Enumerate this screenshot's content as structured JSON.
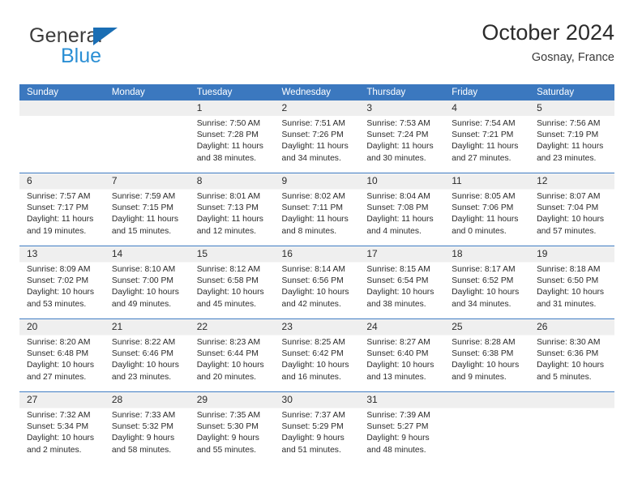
{
  "brand": {
    "name_top": "General",
    "name_bottom": "Blue",
    "triangle_color": "#1a6eb4",
    "blue_text_color": "#2b8fd4"
  },
  "header": {
    "title": "October 2024",
    "location": "Gosnay, France"
  },
  "theme": {
    "header_row_bg": "#3b78bf",
    "header_row_text": "#ffffff",
    "daynum_band_bg": "#efefef",
    "row_divider": "#3b78bf",
    "body_text": "#2b2b2b"
  },
  "calendar": {
    "weekday_headers": [
      "Sunday",
      "Monday",
      "Tuesday",
      "Wednesday",
      "Thursday",
      "Friday",
      "Saturday"
    ],
    "labels": {
      "sunrise": "Sunrise:",
      "sunset": "Sunset:",
      "daylight": "Daylight:"
    },
    "weeks": [
      [
        {
          "day": "",
          "sunrise": "",
          "sunset": "",
          "daylight": ""
        },
        {
          "day": "",
          "sunrise": "",
          "sunset": "",
          "daylight": ""
        },
        {
          "day": "1",
          "sunrise": "Sunrise: 7:50 AM",
          "sunset": "Sunset: 7:28 PM",
          "daylight": "Daylight: 11 hours and 38 minutes."
        },
        {
          "day": "2",
          "sunrise": "Sunrise: 7:51 AM",
          "sunset": "Sunset: 7:26 PM",
          "daylight": "Daylight: 11 hours and 34 minutes."
        },
        {
          "day": "3",
          "sunrise": "Sunrise: 7:53 AM",
          "sunset": "Sunset: 7:24 PM",
          "daylight": "Daylight: 11 hours and 30 minutes."
        },
        {
          "day": "4",
          "sunrise": "Sunrise: 7:54 AM",
          "sunset": "Sunset: 7:21 PM",
          "daylight": "Daylight: 11 hours and 27 minutes."
        },
        {
          "day": "5",
          "sunrise": "Sunrise: 7:56 AM",
          "sunset": "Sunset: 7:19 PM",
          "daylight": "Daylight: 11 hours and 23 minutes."
        }
      ],
      [
        {
          "day": "6",
          "sunrise": "Sunrise: 7:57 AM",
          "sunset": "Sunset: 7:17 PM",
          "daylight": "Daylight: 11 hours and 19 minutes."
        },
        {
          "day": "7",
          "sunrise": "Sunrise: 7:59 AM",
          "sunset": "Sunset: 7:15 PM",
          "daylight": "Daylight: 11 hours and 15 minutes."
        },
        {
          "day": "8",
          "sunrise": "Sunrise: 8:01 AM",
          "sunset": "Sunset: 7:13 PM",
          "daylight": "Daylight: 11 hours and 12 minutes."
        },
        {
          "day": "9",
          "sunrise": "Sunrise: 8:02 AM",
          "sunset": "Sunset: 7:11 PM",
          "daylight": "Daylight: 11 hours and 8 minutes."
        },
        {
          "day": "10",
          "sunrise": "Sunrise: 8:04 AM",
          "sunset": "Sunset: 7:08 PM",
          "daylight": "Daylight: 11 hours and 4 minutes."
        },
        {
          "day": "11",
          "sunrise": "Sunrise: 8:05 AM",
          "sunset": "Sunset: 7:06 PM",
          "daylight": "Daylight: 11 hours and 0 minutes."
        },
        {
          "day": "12",
          "sunrise": "Sunrise: 8:07 AM",
          "sunset": "Sunset: 7:04 PM",
          "daylight": "Daylight: 10 hours and 57 minutes."
        }
      ],
      [
        {
          "day": "13",
          "sunrise": "Sunrise: 8:09 AM",
          "sunset": "Sunset: 7:02 PM",
          "daylight": "Daylight: 10 hours and 53 minutes."
        },
        {
          "day": "14",
          "sunrise": "Sunrise: 8:10 AM",
          "sunset": "Sunset: 7:00 PM",
          "daylight": "Daylight: 10 hours and 49 minutes."
        },
        {
          "day": "15",
          "sunrise": "Sunrise: 8:12 AM",
          "sunset": "Sunset: 6:58 PM",
          "daylight": "Daylight: 10 hours and 45 minutes."
        },
        {
          "day": "16",
          "sunrise": "Sunrise: 8:14 AM",
          "sunset": "Sunset: 6:56 PM",
          "daylight": "Daylight: 10 hours and 42 minutes."
        },
        {
          "day": "17",
          "sunrise": "Sunrise: 8:15 AM",
          "sunset": "Sunset: 6:54 PM",
          "daylight": "Daylight: 10 hours and 38 minutes."
        },
        {
          "day": "18",
          "sunrise": "Sunrise: 8:17 AM",
          "sunset": "Sunset: 6:52 PM",
          "daylight": "Daylight: 10 hours and 34 minutes."
        },
        {
          "day": "19",
          "sunrise": "Sunrise: 8:18 AM",
          "sunset": "Sunset: 6:50 PM",
          "daylight": "Daylight: 10 hours and 31 minutes."
        }
      ],
      [
        {
          "day": "20",
          "sunrise": "Sunrise: 8:20 AM",
          "sunset": "Sunset: 6:48 PM",
          "daylight": "Daylight: 10 hours and 27 minutes."
        },
        {
          "day": "21",
          "sunrise": "Sunrise: 8:22 AM",
          "sunset": "Sunset: 6:46 PM",
          "daylight": "Daylight: 10 hours and 23 minutes."
        },
        {
          "day": "22",
          "sunrise": "Sunrise: 8:23 AM",
          "sunset": "Sunset: 6:44 PM",
          "daylight": "Daylight: 10 hours and 20 minutes."
        },
        {
          "day": "23",
          "sunrise": "Sunrise: 8:25 AM",
          "sunset": "Sunset: 6:42 PM",
          "daylight": "Daylight: 10 hours and 16 minutes."
        },
        {
          "day": "24",
          "sunrise": "Sunrise: 8:27 AM",
          "sunset": "Sunset: 6:40 PM",
          "daylight": "Daylight: 10 hours and 13 minutes."
        },
        {
          "day": "25",
          "sunrise": "Sunrise: 8:28 AM",
          "sunset": "Sunset: 6:38 PM",
          "daylight": "Daylight: 10 hours and 9 minutes."
        },
        {
          "day": "26",
          "sunrise": "Sunrise: 8:30 AM",
          "sunset": "Sunset: 6:36 PM",
          "daylight": "Daylight: 10 hours and 5 minutes."
        }
      ],
      [
        {
          "day": "27",
          "sunrise": "Sunrise: 7:32 AM",
          "sunset": "Sunset: 5:34 PM",
          "daylight": "Daylight: 10 hours and 2 minutes."
        },
        {
          "day": "28",
          "sunrise": "Sunrise: 7:33 AM",
          "sunset": "Sunset: 5:32 PM",
          "daylight": "Daylight: 9 hours and 58 minutes."
        },
        {
          "day": "29",
          "sunrise": "Sunrise: 7:35 AM",
          "sunset": "Sunset: 5:30 PM",
          "daylight": "Daylight: 9 hours and 55 minutes."
        },
        {
          "day": "30",
          "sunrise": "Sunrise: 7:37 AM",
          "sunset": "Sunset: 5:29 PM",
          "daylight": "Daylight: 9 hours and 51 minutes."
        },
        {
          "day": "31",
          "sunrise": "Sunrise: 7:39 AM",
          "sunset": "Sunset: 5:27 PM",
          "daylight": "Daylight: 9 hours and 48 minutes."
        },
        {
          "day": "",
          "sunrise": "",
          "sunset": "",
          "daylight": ""
        },
        {
          "day": "",
          "sunrise": "",
          "sunset": "",
          "daylight": ""
        }
      ]
    ]
  }
}
